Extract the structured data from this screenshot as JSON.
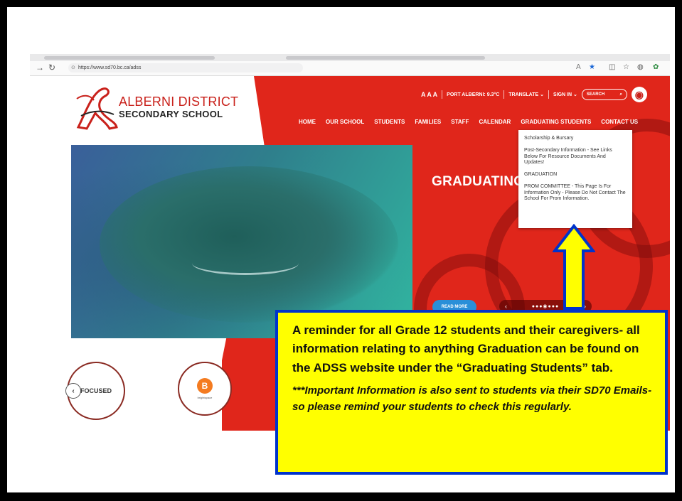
{
  "browser": {
    "url": "https://www.sd70.bc.ca/adss"
  },
  "site": {
    "logo_line1": "ALBERNI DISTRICT",
    "logo_line2": "SECONDARY SCHOOL",
    "utility": {
      "text_size": "A A A",
      "weather": "PORT ALBERNI: 9.3°C",
      "translate": "TRANSLATE",
      "sign_in": "SIGN IN",
      "search_placeholder": "SEARCH"
    },
    "nav": [
      "HOME",
      "OUR SCHOOL",
      "STUDENTS",
      "FAMILIES",
      "STAFF",
      "CALENDAR",
      "GRADUATING STUDENTS",
      "CONTACT US"
    ],
    "dropdown": [
      "Scholarship & Bursary",
      "Post-Secondary Information - See Links Below For Resource Documents And Updates!",
      "GRADUATION",
      "PROM COMMITTEE - This Page Is For Information Only - Please Do Not Contact The School For Prom Information."
    ],
    "hero_title": "GRADUATING ST",
    "read_more": "READ MORE",
    "partners": [
      "FOCUSED",
      "brightspace"
    ]
  },
  "callout": {
    "main": "A reminder for all Grade 12 students and their caregivers- all information relating to anything Graduation can be found on the ADSS website under the “Graduating Students” tab.",
    "note": "***Important Information is also sent to students via their SD70 Emails- so please remind your students to check this regularly."
  },
  "colors": {
    "brand_red": "#e0261b",
    "callout_yellow": "#ffff00",
    "callout_border": "#0033cc"
  }
}
